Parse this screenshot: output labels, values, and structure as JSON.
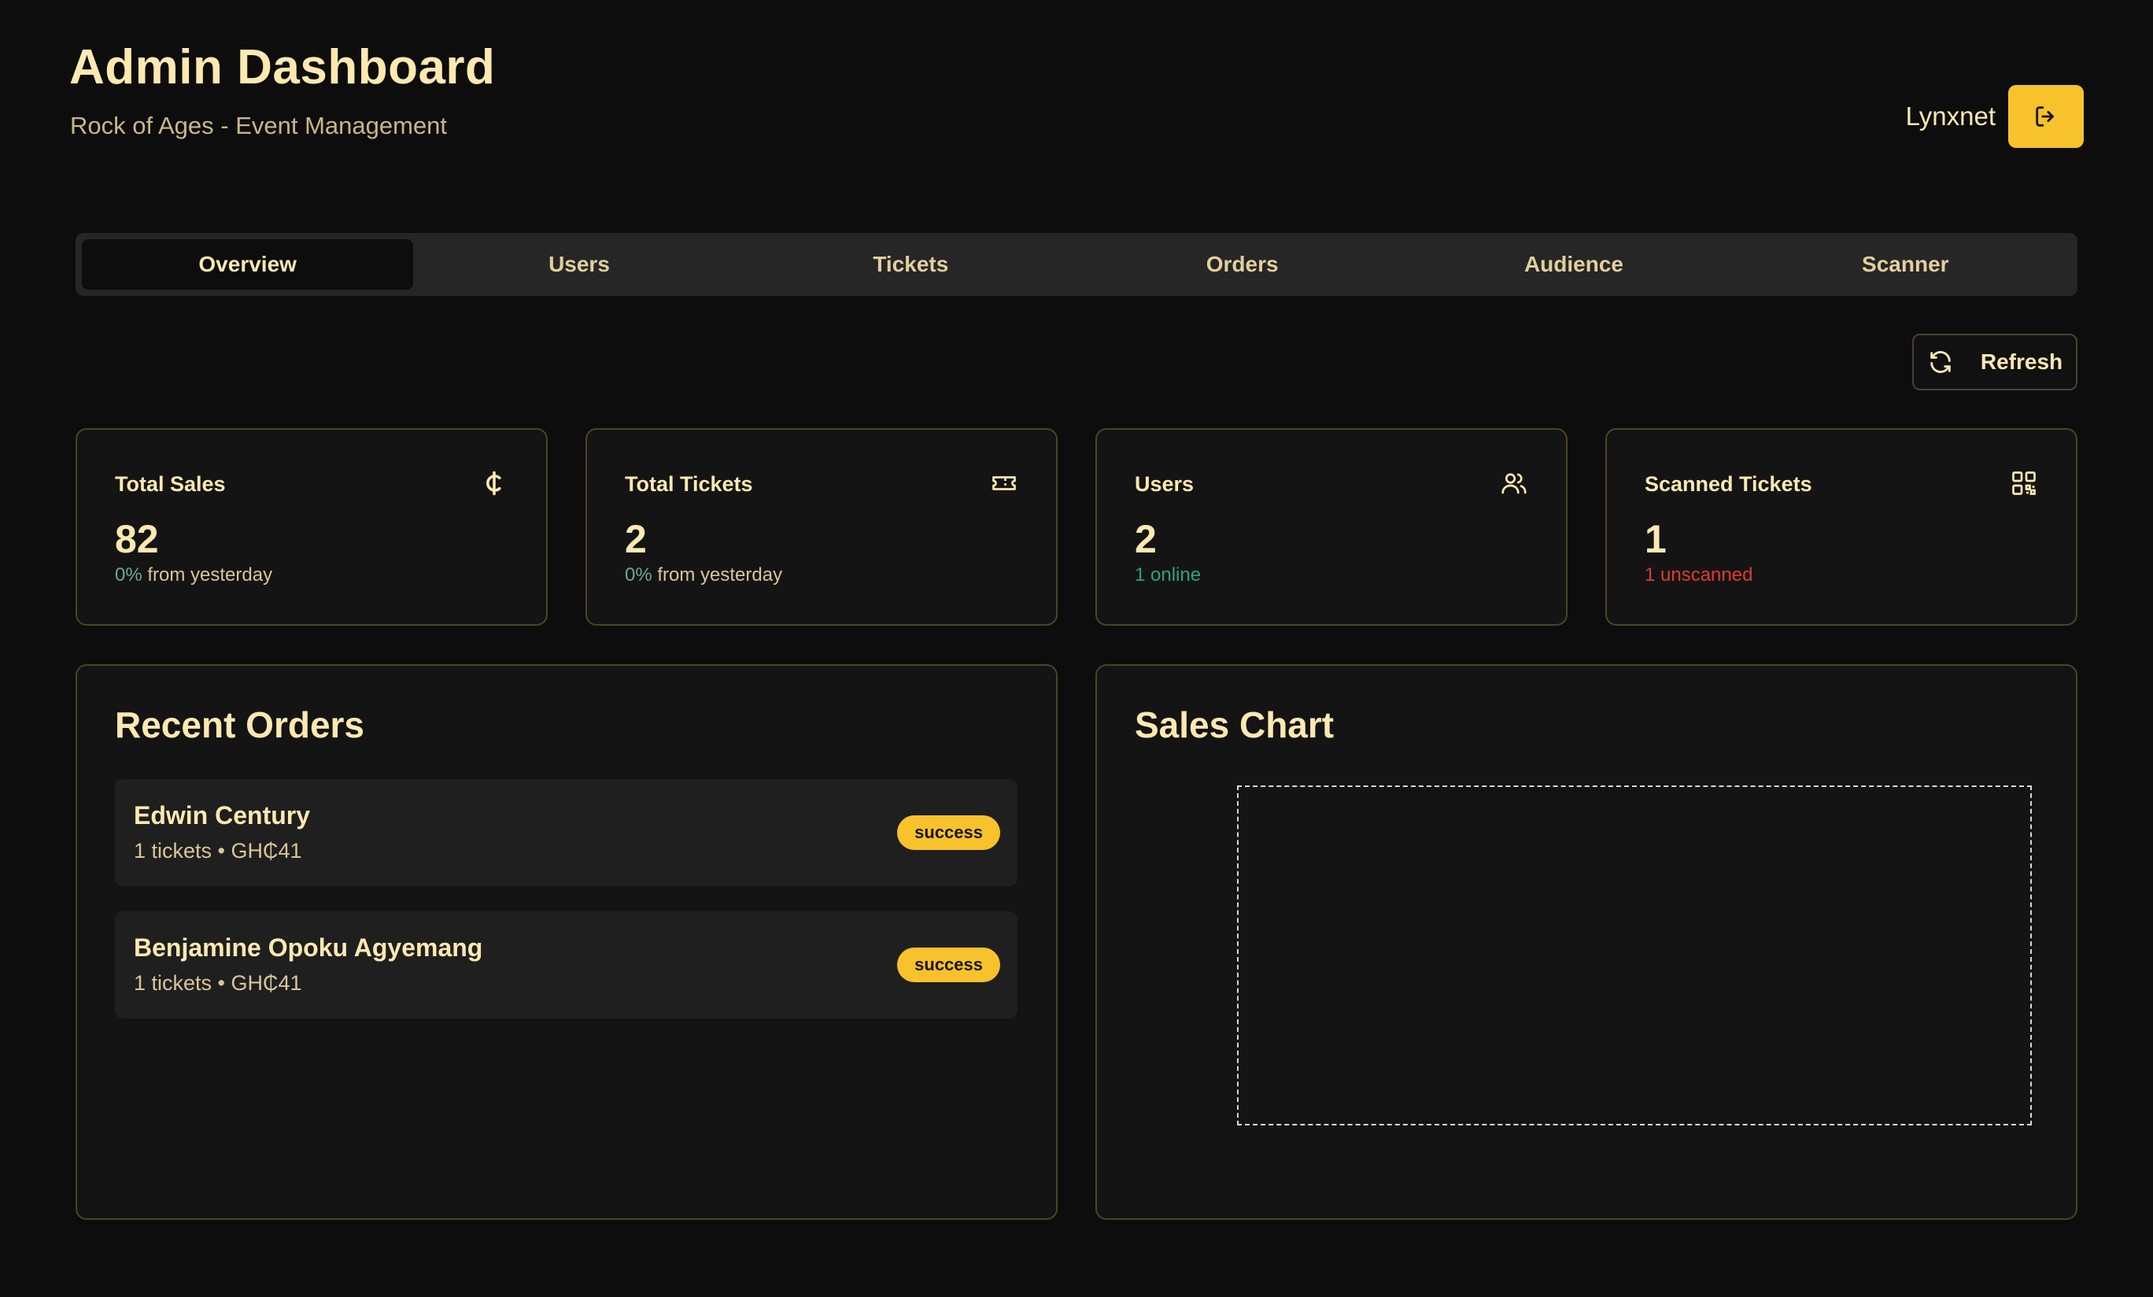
{
  "header": {
    "title": "Admin Dashboard",
    "subtitle": "Rock of Ages - Event Management",
    "user_name": "Lynxnet",
    "logout_icon": "logout-icon"
  },
  "tabs": [
    {
      "label": "Overview",
      "active": true
    },
    {
      "label": "Users"
    },
    {
      "label": "Tickets"
    },
    {
      "label": "Orders"
    },
    {
      "label": "Audience"
    },
    {
      "label": "Scanner"
    }
  ],
  "toolbar": {
    "refresh_label": "Refresh",
    "refresh_icon": "refresh-icon"
  },
  "stats": {
    "sales": {
      "title": "Total Sales",
      "value": "82",
      "pct": "0%",
      "sub": " from yesterday",
      "icon": "cedi-icon"
    },
    "tickets": {
      "title": "Total Tickets",
      "value": "2",
      "pct": "0%",
      "sub": " from yesterday",
      "icon": "ticket-icon"
    },
    "users": {
      "title": "Users",
      "value": "2",
      "sub": "1 online",
      "icon": "users-icon"
    },
    "scanned": {
      "title": "Scanned Tickets",
      "value": "1",
      "sub": "1 unscanned",
      "icon": "qr-code-icon"
    }
  },
  "recent_orders": {
    "title": "Recent Orders",
    "items": [
      {
        "name": "Edwin Century",
        "meta": "1 tickets • GH₵41",
        "status": "success"
      },
      {
        "name": "Benjamine Opoku Agyemang",
        "meta": "1 tickets • GH₵41",
        "status": "success"
      }
    ]
  },
  "sales_chart": {
    "title": "Sales Chart"
  },
  "colors": {
    "accent": "#f7c22b",
    "background": "#0d0d0d",
    "text": "#fde9b0",
    "online": "#2fa37a",
    "unscanned": "#e03a2f"
  }
}
